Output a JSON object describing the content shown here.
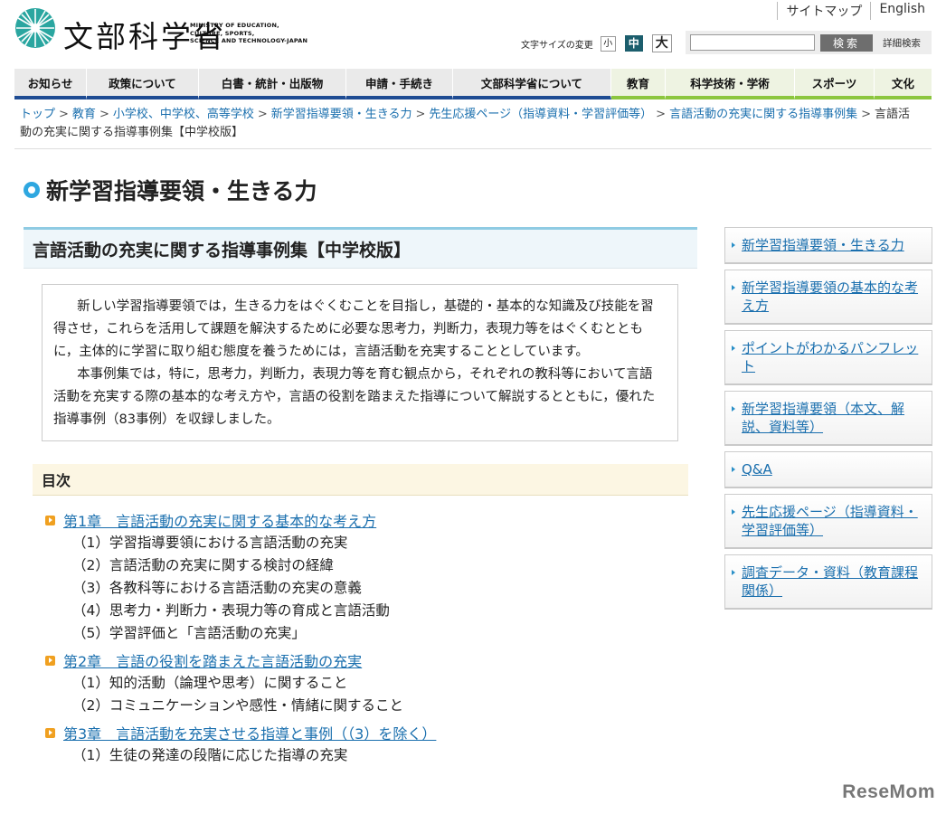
{
  "header": {
    "logo_text": "文部科学省",
    "logo_sub": [
      "MINISTRY OF EDUCATION,",
      "CULTURE, SPORTS,",
      "SCIENCE AND TECHNOLOGY-JAPAN"
    ],
    "top_links": [
      "サイトマップ",
      "English"
    ],
    "font_size_label": "文字サイズの変更",
    "font_small": "小",
    "font_medium": "中",
    "font_large": "大",
    "search_placeholder": "",
    "search_button": "検索",
    "search_detail": "詳細検索"
  },
  "nav": [
    {
      "label": "お知らせ"
    },
    {
      "label": "政策について"
    },
    {
      "label": "白書・統計・出版物"
    },
    {
      "label": "申請・手続き"
    },
    {
      "label": "文部科学省について"
    },
    {
      "label": "教育"
    },
    {
      "label": "科学技術・学術"
    },
    {
      "label": "スポーツ"
    },
    {
      "label": "文化"
    }
  ],
  "breadcrumb": [
    "トップ",
    "教育",
    "小学校、中学校、高等学校",
    "新学習指導要領・生きる力",
    "先生応援ページ（指導資料・学習評価等）",
    "言語活動の充実に関する指導事例集",
    "言語活動の充実に関する指導事例集【中学校版】"
  ],
  "page_title": "新学習指導要領・生きる力",
  "main": {
    "subtitle": "言語活動の充実に関する指導事例集【中学校版】",
    "intro_p1": "新しい学習指導要領では，生きる力をはぐくむことを目指し，基礎的・基本的な知識及び技能を習得させ，これらを活用して課題を解決するために必要な思考力，判断力，表現力等をはぐくむとともに，主体的に学習に取り組む態度を養うためには，言語活動を充実することとしています。",
    "intro_p2": "本事例集では，特に，思考力，判断力，表現力等を育む観点から，それぞれの教科等において言語活動を充実する際の基本的な考え方や，言語の役割を踏まえた指導について解説するとともに，優れた指導事例（83事例）を収録しました。",
    "toc_heading": "目次",
    "chapters": [
      {
        "title": "第1章　言語活動の充実に関する基本的な考え方",
        "items": [
          "（1）学習指導要領における言語活動の充実",
          "（2）言語活動の充実に関する検討の経緯",
          "（3）各教科等における言語活動の充実の意義",
          "（4）思考力・判断力・表現力等の育成と言語活動",
          "（5）学習評価と「言語活動の充実」"
        ]
      },
      {
        "title": "第2章　言語の役割を踏まえた言語活動の充実",
        "items": [
          "（1）知的活動（論理や思考）に関すること",
          "（2）コミュニケーションや感性・情緒に関すること"
        ]
      },
      {
        "title": "第3章　言語活動を充実させる指導と事例（（3）を除く）",
        "items": [
          "（1）生徒の発達の段階に応じた指導の充実"
        ]
      }
    ]
  },
  "sidebar": [
    "新学習指導要領・生きる力",
    "新学習指導要領の基本的な考え方",
    "ポイントがわかるパンフレット",
    "新学習指導要領（本文、解説、資料等）",
    "Q&A",
    "先生応援ページ（指導資料・学習評価等）",
    "調査データ・資料（教育課程関係）"
  ],
  "watermark": "ReseMom",
  "colors": {
    "nav_blue": "#1f4c93",
    "nav_green": "#8cc63f",
    "link": "#1a6fae",
    "accent": "#2ea7e0"
  }
}
